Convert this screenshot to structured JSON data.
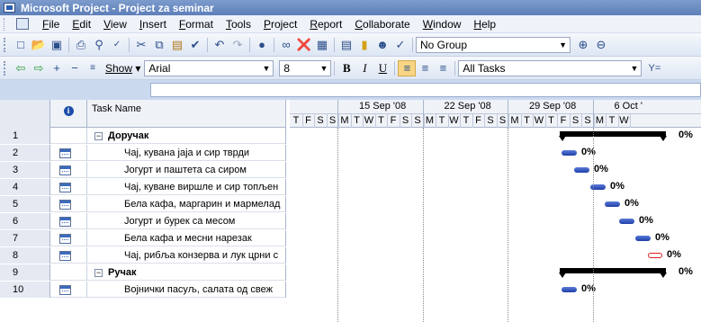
{
  "window": {
    "title": "Microsoft Project - Project za seminar"
  },
  "menu": {
    "items": [
      {
        "label": "File"
      },
      {
        "label": "Edit"
      },
      {
        "label": "View"
      },
      {
        "label": "Insert"
      },
      {
        "label": "Format"
      },
      {
        "label": "Tools"
      },
      {
        "label": "Project"
      },
      {
        "label": "Report"
      },
      {
        "label": "Collaborate"
      },
      {
        "label": "Window"
      },
      {
        "label": "Help"
      }
    ]
  },
  "toolbar1": {
    "icons": [
      "new-icon",
      "open-icon",
      "save-icon",
      "print-icon",
      "print-preview-icon",
      "spelling-icon",
      "cut-icon",
      "copy-icon",
      "paste-icon",
      "format-painter-icon",
      "undo-icon",
      "redo-icon",
      "link-tasks-icon",
      "unlink-tasks-icon",
      "split-task-icon",
      "task-info-icon",
      "notes-icon",
      "assign-resources-icon",
      "publish-icon"
    ],
    "group_value": "No Group"
  },
  "toolbar2": {
    "show_label": "Show",
    "font_value": "Arial",
    "size_value": "8",
    "bold_label": "B",
    "italic_label": "I",
    "underline_label": "U",
    "filter_value": "All Tasks"
  },
  "grid": {
    "header": {
      "task_name": "Task Name"
    },
    "rows": [
      {
        "id": "1",
        "name": "Доручак",
        "summary": true
      },
      {
        "id": "2",
        "name": "Чај, кувана јаја и сир тврди",
        "summary": false
      },
      {
        "id": "3",
        "name": "Јогурт и паштета са сиром",
        "summary": false
      },
      {
        "id": "4",
        "name": "Чај, куване виршле и сир топљен",
        "summary": false
      },
      {
        "id": "5",
        "name": "Бела кафа, маргарин и мармелад",
        "summary": false
      },
      {
        "id": "6",
        "name": "Јогурт и бурек са месом",
        "summary": false
      },
      {
        "id": "7",
        "name": "Бела кафа и месни нарезак",
        "summary": false
      },
      {
        "id": "8",
        "name": "Чај, рибља конзерва и лук црни с",
        "summary": false
      },
      {
        "id": "9",
        "name": "Ручак",
        "summary": true
      },
      {
        "id": "10",
        "name": "Војнички пасуљ, салата од свеж",
        "summary": false
      }
    ]
  },
  "gantt": {
    "weeks": [
      "15 Sep '08",
      "22 Sep '08",
      "29 Sep '08",
      "6 Oct '"
    ],
    "days": [
      "T",
      "F",
      "S",
      "S",
      "M",
      "T",
      "W",
      "T",
      "F",
      "S",
      "S",
      "M",
      "T",
      "W",
      "T",
      "F",
      "S",
      "S",
      "M",
      "T",
      "W",
      "T",
      "F",
      "S",
      "S",
      "M",
      "T",
      "W"
    ],
    "bars": [
      {
        "row": 0,
        "type": "summary",
        "label": "0%"
      },
      {
        "row": 1,
        "type": "task",
        "label": "0%"
      },
      {
        "row": 2,
        "type": "task",
        "label": "0%"
      },
      {
        "row": 3,
        "type": "task",
        "label": "0%"
      },
      {
        "row": 4,
        "type": "task",
        "label": "0%"
      },
      {
        "row": 5,
        "type": "task",
        "label": "0%"
      },
      {
        "row": 6,
        "type": "task",
        "label": "0%"
      },
      {
        "row": 7,
        "type": "critical",
        "label": "0%"
      },
      {
        "row": 8,
        "type": "summary",
        "label": "0%"
      },
      {
        "row": 9,
        "type": "task",
        "label": "0%"
      }
    ]
  }
}
